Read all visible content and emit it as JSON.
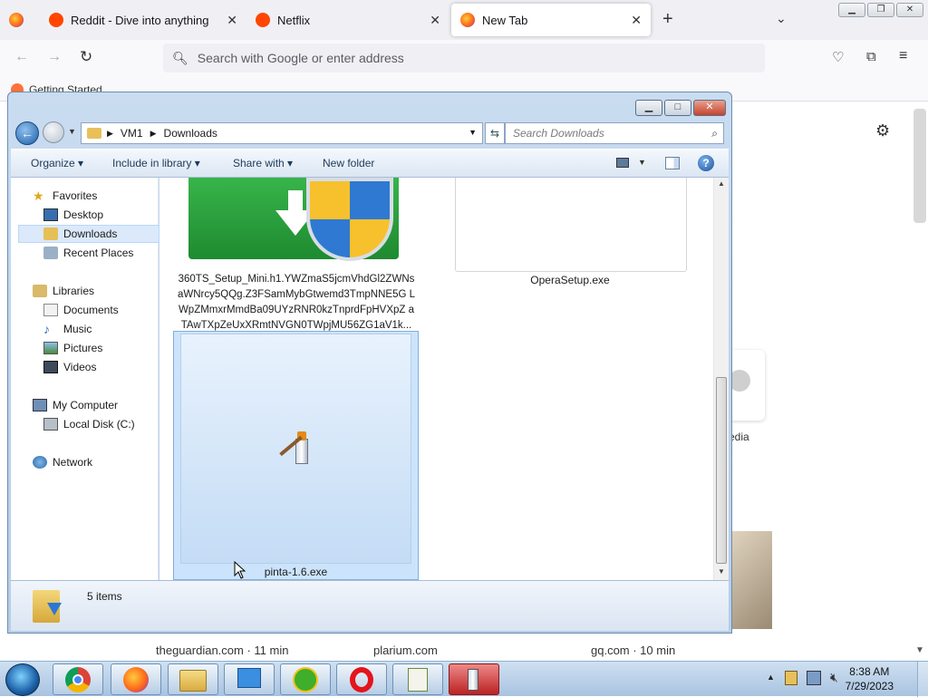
{
  "firefox": {
    "tabs": [
      {
        "label": "",
        "icon": "firefox-icon"
      },
      {
        "label": "Reddit - Dive into anything",
        "icon": "reddit-icon"
      },
      {
        "label": "Netflix",
        "icon": "reddit-icon"
      },
      {
        "label": "New Tab",
        "icon": "firefox-icon"
      }
    ],
    "address_placeholder": "Search with Google or enter address",
    "bookmark": "Getting Started",
    "shortcut_partial_label": "edia",
    "site_cards": [
      {
        "label": "theguardian.com · 11 min"
      },
      {
        "label": "plarium.com"
      },
      {
        "label": "gq.com · 10 min"
      }
    ]
  },
  "explorer": {
    "breadcrumb": [
      "VM1",
      "Downloads"
    ],
    "search_placeholder": "Search Downloads",
    "commands": {
      "organize": "Organize",
      "include": "Include in library",
      "share": "Share with",
      "new_folder": "New folder"
    },
    "nav": {
      "favorites": "Favorites",
      "desktop": "Desktop",
      "downloads": "Downloads",
      "recent": "Recent Places",
      "libraries": "Libraries",
      "documents": "Documents",
      "music": "Music",
      "pictures": "Pictures",
      "videos": "Videos",
      "computer": "My Computer",
      "local_disk": "Local Disk (C:)",
      "network": "Network"
    },
    "files": [
      {
        "name": "360TS_Setup_Mini.h1.YWZmaS5jcmVhdGl2ZWNsaWNrcy5QQg.Z3FSamMybGtwemd3TmpNNE5GLWpZMmxrMmdBa09UYzRNR0kzTnprdFpHVXpZaTAwTXpZeUxXRmtNVGN0TWpjMU56ZG1aV1k...",
        "display": "360TS_Setup_Mini.h1.YWZmaS5jcmVhdGl2ZWNs aWNrcy5QQg.Z3FSamMybGtwemd3TmpNNE5G LWpZMmxrMmdBa09UYzRNR0kzTnprdFpHVXpZ aTAwTXpZeUxXRmtNVGN0TWpjMU56ZG1aV1k..."
      },
      {
        "name": "OperaSetup.exe"
      },
      {
        "name": "pinta-1.6.exe"
      }
    ],
    "status": "5 items"
  },
  "taskbar": {
    "time": "8:38 AM",
    "date": "7/29/2023"
  },
  "colors": {
    "selection": "#cce4fb",
    "explorer_frame": "#b9d1ea",
    "taskbar": "#b7cfe8"
  }
}
